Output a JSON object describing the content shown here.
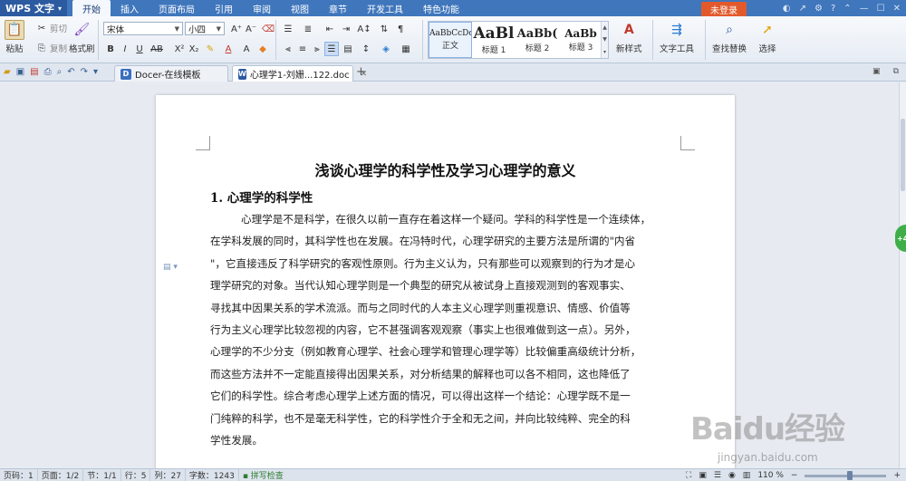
{
  "app": {
    "name": "WPS 文字"
  },
  "menu": {
    "tabs": [
      "开始",
      "插入",
      "页面布局",
      "引用",
      "审阅",
      "视图",
      "章节",
      "开发工具",
      "特色功能"
    ],
    "active": 0,
    "login_label": "未登录"
  },
  "ribbon": {
    "paste_label": "粘贴",
    "cut_label": "剪切",
    "copy_label": "复制",
    "format_painter_label": "格式刷",
    "font_name": "宋体",
    "font_size": "小四",
    "styles": [
      {
        "preview": "AaBbCcDc",
        "label": "正文"
      },
      {
        "preview": "AaBl",
        "label": "标题 1"
      },
      {
        "preview": "AaBb(",
        "label": "标题 2"
      },
      {
        "preview": "AaBb",
        "label": "标题 3"
      }
    ],
    "new_style_label": "新样式",
    "text_tools_label": "文字工具",
    "find_replace_label": "查找替换",
    "select_label": "选择"
  },
  "tabs": {
    "docs": [
      {
        "title": "Docer-在线模板",
        "active": false
      },
      {
        "title": "心理学1-刘姗...122.doc",
        "active": true
      }
    ]
  },
  "document": {
    "title": "浅谈心理学的科学性及学习心理学的意义",
    "heading": "1. 心理学的科学性",
    "lines": [
      "心理学是不是科学，在很久以前一直存在着这样一个疑问。学科的科学性是一个连续体，",
      "在学科发展的同时，其科学性也在发展。在冯特时代，心理学研究的主要方法是所谓的\"内省",
      "\"，它直接违反了科学研究的客观性原则。行为主义认为，只有那些可以观察到的行为才是心",
      "理学研究的对象。当代认知心理学则是一个典型的研究从被试身上直接观测到的客观事实、",
      "寻找其中因果关系的学术流派。而与之同时代的人本主义心理学则重视意识、情感、价值等",
      "行为主义心理学比较忽视的内容，它不甚强调客观观察（事实上也很难做到这一点）。另外，",
      "心理学的不少分支（例如教育心理学、社会心理学和管理心理学等）比较偏重高级统计分析，",
      "而这些方法并不一定能直接得出因果关系，对分析结果的解释也可以各不相同，这也降低了",
      "它们的科学性。综合考虑心理学上述方面的情况，可以得出这样一个结论：心理学既不是一",
      "门纯粹的科学，也不是毫无科学性，它的科学性介于全和无之间，并向比较纯粹、完全的科",
      "学性发展。"
    ]
  },
  "status": {
    "page_code": "页码：1",
    "pages": "页面：1/2",
    "section": "节：1/1",
    "row": "行：5",
    "col": "列：27",
    "words": "字数：1243",
    "spell": "拼写检查",
    "zoom": "110 %",
    "zoom_level": 0.55
  },
  "side_badge": "+4",
  "watermark": {
    "logo": "Baidu经验",
    "sub": "jingyan.baidu.com"
  }
}
